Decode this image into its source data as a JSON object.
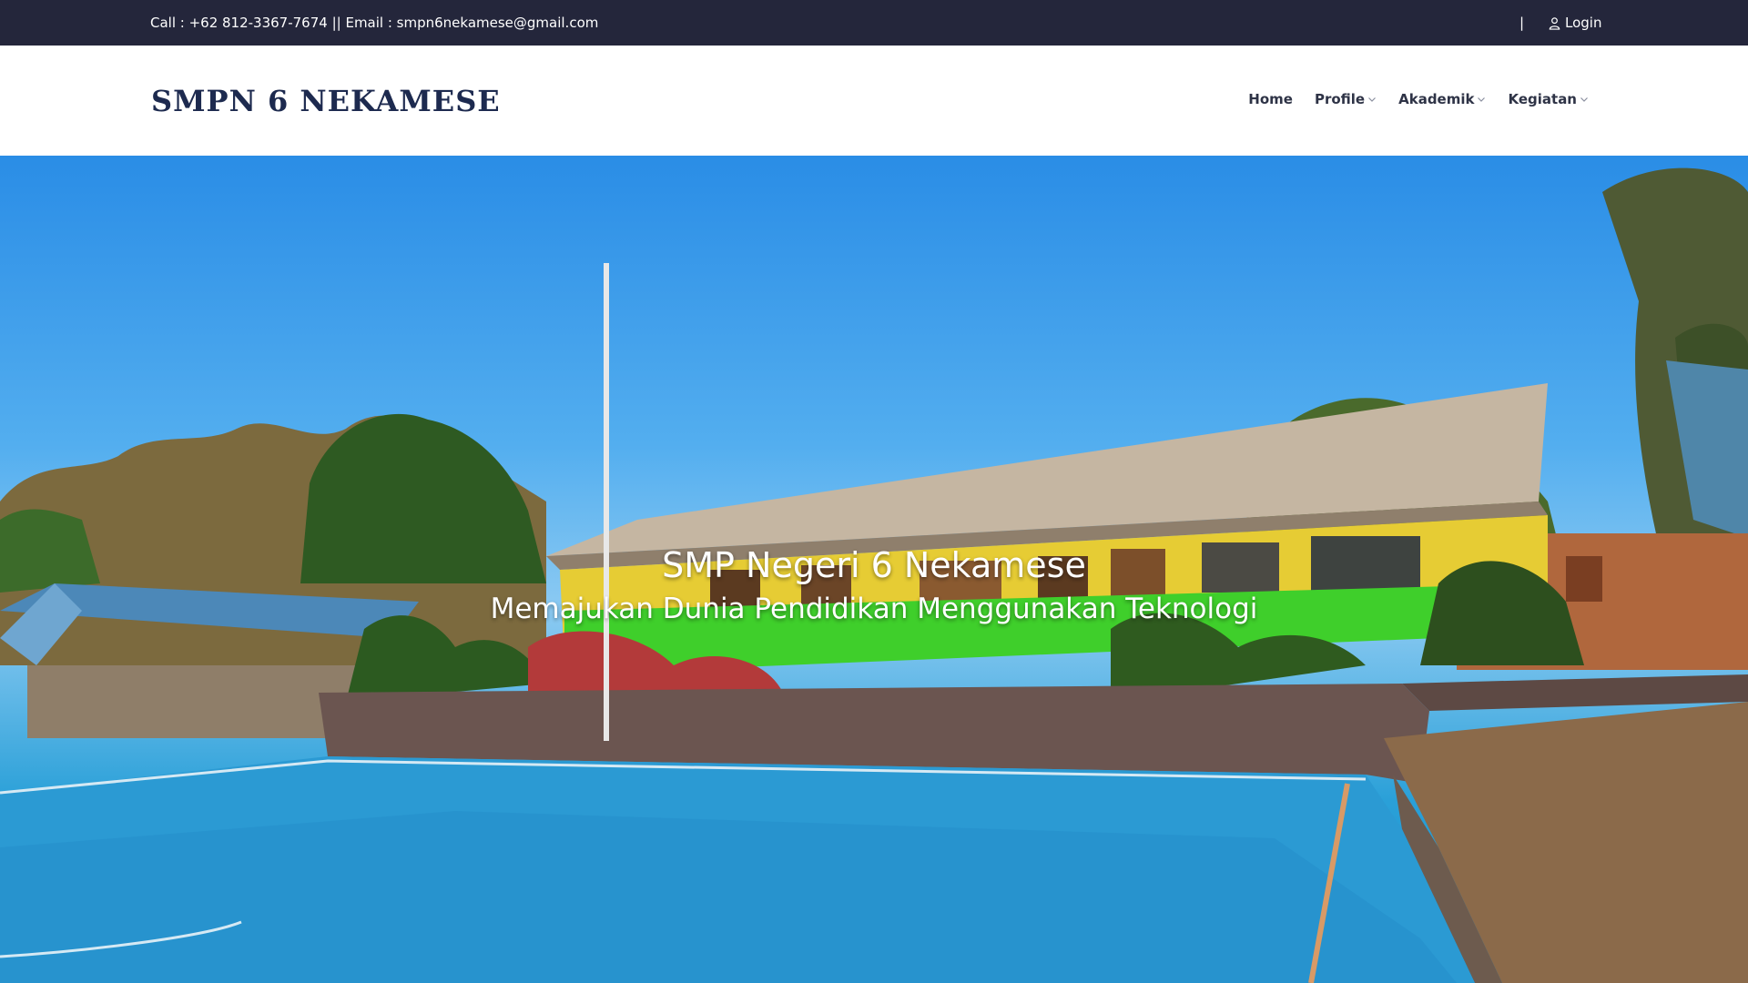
{
  "topbar": {
    "contact": "Call : +62 812-3367-7674 || Email : smpn6nekamese@gmail.com",
    "separator": "|",
    "login_label": "Login",
    "login_icon": "user-icon",
    "background": "#24263b"
  },
  "header": {
    "brand": "SMPN 6 NEKAMESE",
    "brand_color": "#1d2a4f",
    "nav": [
      {
        "label": "Home",
        "has_dropdown": false
      },
      {
        "label": "Profile",
        "has_dropdown": true
      },
      {
        "label": "Akademik",
        "has_dropdown": true
      },
      {
        "label": "Kegiatan",
        "has_dropdown": true
      }
    ]
  },
  "hero": {
    "title": "SMP Negeri 6 Nekamese",
    "subtitle": "Memajukan Dunia Pendidikan Menggunakan Teknologi"
  }
}
